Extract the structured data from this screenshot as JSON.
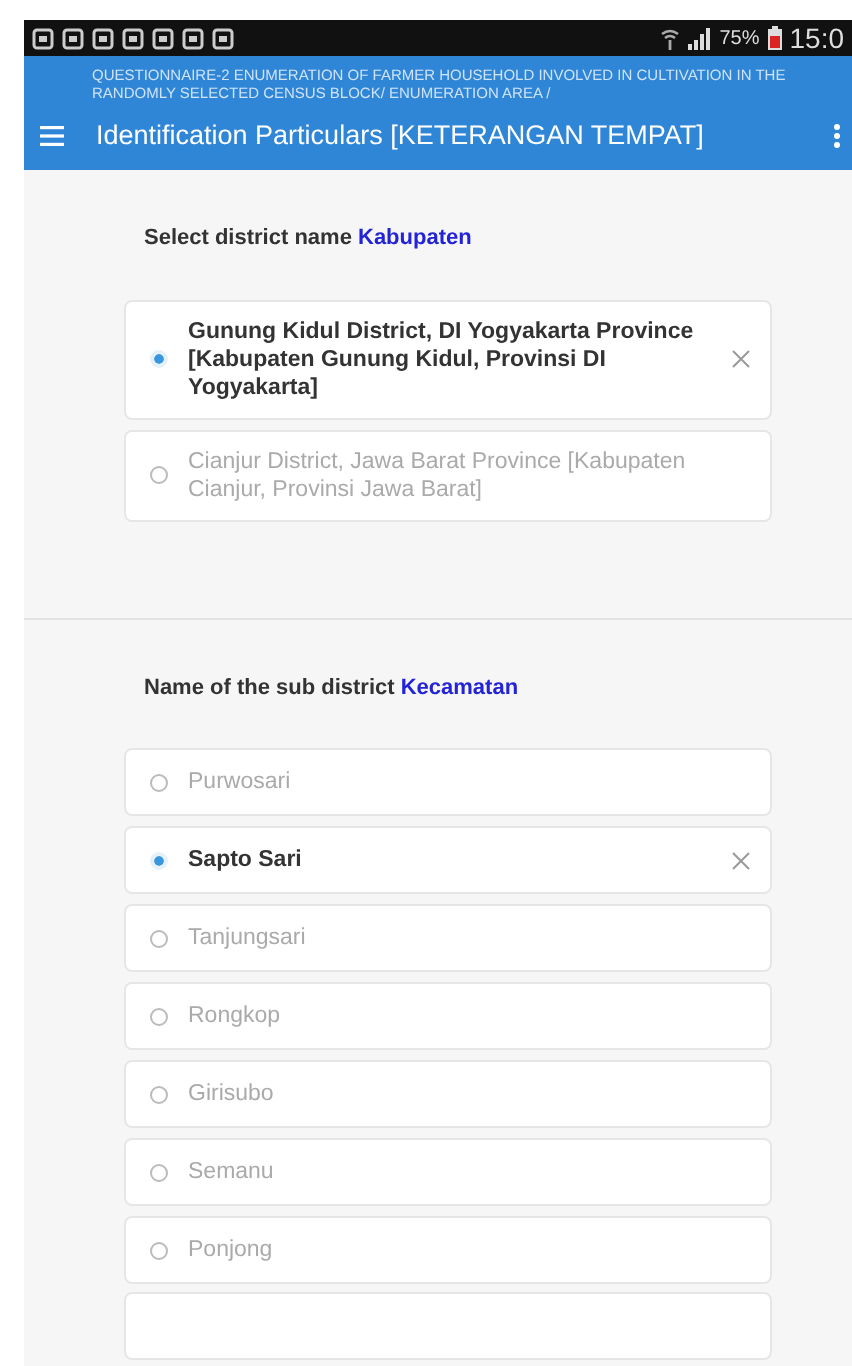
{
  "status_bar": {
    "battery_text": "75%",
    "time": "15:0"
  },
  "header": {
    "subtitle": "QUESTIONNAIRE-2 ENUMERATION OF FARMER HOUSEHOLD INVOLVED IN CULTIVATION IN THE RANDOMLY SELECTED CENSUS BLOCK/ ENUMERATION AREA /",
    "title": "Identification Particulars [KETERANGAN TEMPAT]"
  },
  "questions": [
    {
      "label": "Select district name",
      "label_term": "Kabupaten",
      "options": [
        {
          "text": "Gunung Kidul District, DI Yogyakarta Province [Kabupaten Gunung Kidul, Provinsi DI Yogyakarta]",
          "selected": true
        },
        {
          "text": "Cianjur District, Jawa Barat Province [Kabupaten Cianjur, Provinsi Jawa Barat]",
          "selected": false
        }
      ]
    },
    {
      "label": "Name of the sub district",
      "label_term": "Kecamatan",
      "options": [
        {
          "text": "Purwosari",
          "selected": false
        },
        {
          "text": "Sapto Sari",
          "selected": true
        },
        {
          "text": "Tanjungsari",
          "selected": false
        },
        {
          "text": "Rongkop",
          "selected": false
        },
        {
          "text": "Girisubo",
          "selected": false
        },
        {
          "text": "Semanu",
          "selected": false
        },
        {
          "text": "Ponjong",
          "selected": false
        }
      ]
    }
  ]
}
